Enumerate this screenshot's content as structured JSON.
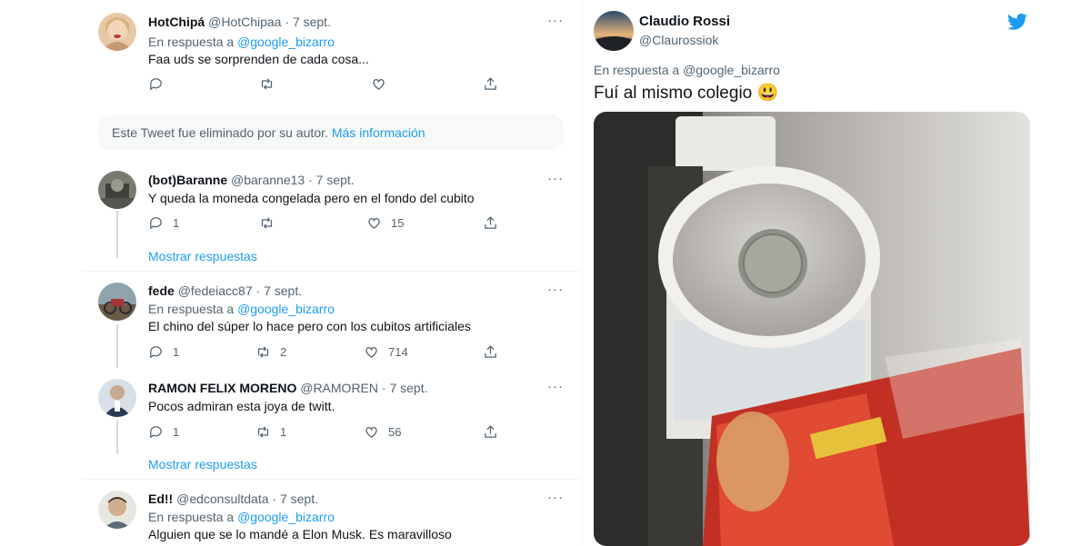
{
  "thread": {
    "tweets": [
      {
        "name": "HotChipá",
        "handle": "@HotChipaa",
        "sep": "·",
        "date": "7 sept.",
        "reply_prefix": "En respuesta a",
        "reply_to": "@google_bizarro",
        "text": "Faa uds se sorprenden de cada cosa...",
        "replies": "",
        "retweets": "",
        "likes": ""
      },
      {
        "name": "(bot)Baranne",
        "handle": "@baranne13",
        "sep": "·",
        "date": "7 sept.",
        "text": "Y queda la moneda congelada pero en el fondo del cubito",
        "replies": "1",
        "retweets": "",
        "likes": "15"
      },
      {
        "name": "fede",
        "handle": "@fedeiacc87",
        "sep": "·",
        "date": "7 sept.",
        "reply_prefix": "En respuesta a",
        "reply_to": "@google_bizarro",
        "text": "El chino del súper lo hace pero con los cubitos artificiales",
        "replies": "1",
        "retweets": "2",
        "likes": "714"
      },
      {
        "name": "RAMON FELIX MORENO",
        "handle": "@RAMOREN",
        "sep": "·",
        "date": "7 sept.",
        "text": "Pocos admiran esta joya de twitt.",
        "replies": "1",
        "retweets": "1",
        "likes": "56"
      },
      {
        "name": "Ed!!",
        "handle": "@edconsultdata",
        "sep": "·",
        "date": "7 sept.",
        "reply_prefix": "En respuesta a",
        "reply_to": "@google_bizarro",
        "text": "Alguien que se lo mandé a Elon Musk. Es maravilloso"
      }
    ],
    "deleted_notice": "Este Tweet fue eliminado por su autor.",
    "more_info": "Más información",
    "show_replies": "Mostrar respuestas",
    "more_dots": "···"
  },
  "card": {
    "name": "Claudio Rossi",
    "handle": "@Claurossiok",
    "reply_prefix": "En respuesta a",
    "reply_to": "@google_bizarro",
    "text": "Fuí al mismo colegio 😃",
    "icon": "twitter-bird-icon"
  },
  "colors": {
    "accent": "#1d9bf0",
    "muted": "#536471",
    "text": "#0f1419"
  }
}
